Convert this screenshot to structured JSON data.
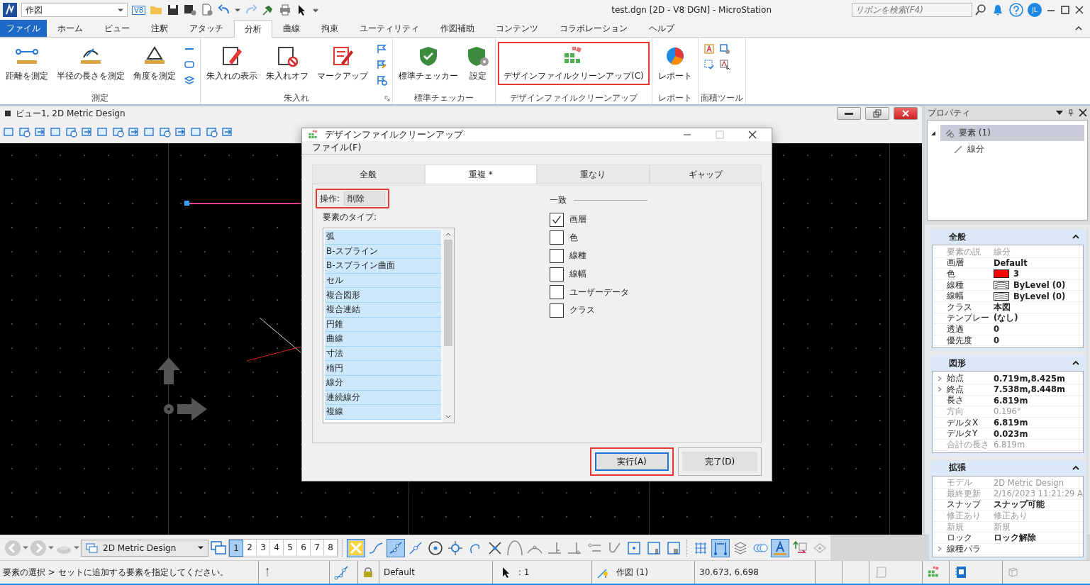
{
  "app": {
    "workflow": "作図",
    "version_badge": "V8",
    "title": "test.dgn [2D - V8 DGN] - MicroStation",
    "search": {
      "placeholder": "リボンを検索(F4)"
    },
    "user_initials": "JL"
  },
  "ribbon": {
    "tabs": [
      {
        "label": "ファイル",
        "kind": "backstage",
        "selected": false
      },
      {
        "label": "ホーム",
        "kind": "tab",
        "selected": false
      },
      {
        "label": "ビュー",
        "kind": "tab",
        "selected": false
      },
      {
        "label": "注釈",
        "kind": "tab",
        "selected": false
      },
      {
        "label": "アタッチ",
        "kind": "tab",
        "selected": false
      },
      {
        "label": "分析",
        "kind": "tab",
        "selected": true
      },
      {
        "label": "曲線",
        "kind": "tab",
        "selected": false
      },
      {
        "label": "拘束",
        "kind": "tab",
        "selected": false
      },
      {
        "label": "ユーティリティ",
        "kind": "tab",
        "selected": false
      },
      {
        "label": "作図補助",
        "kind": "tab",
        "selected": false
      },
      {
        "label": "コンテンツ",
        "kind": "tab",
        "selected": false
      },
      {
        "label": "コラボレーション",
        "kind": "tab",
        "selected": false
      },
      {
        "label": "ヘルプ",
        "kind": "tab",
        "selected": false
      }
    ],
    "groups": [
      {
        "label": "測定",
        "buttons": [
          {
            "label": "距離を測定",
            "highlighted": false
          },
          {
            "label": "半径の長さを測定",
            "highlighted": false
          },
          {
            "label": "角度を測定",
            "highlighted": false
          }
        ]
      },
      {
        "label": "朱入れ",
        "buttons": [
          {
            "label": "朱入れの表示",
            "highlighted": false
          },
          {
            "label": "朱入れオフ",
            "highlighted": false
          },
          {
            "label": "マークアップ",
            "highlighted": false
          }
        ]
      },
      {
        "label": "標準チェッカー",
        "buttons": [
          {
            "label": "標準チェッカー",
            "highlighted": false
          },
          {
            "label": "設定",
            "highlighted": false
          }
        ]
      },
      {
        "label": "デザインファイルクリーンアップ",
        "buttons": [
          {
            "label": "デザインファイルクリーンアップ(C)",
            "highlighted": true
          }
        ]
      },
      {
        "label": "レポート",
        "buttons": [
          {
            "label": "レポート",
            "highlighted": false
          }
        ]
      },
      {
        "label": "面積ツール"
      }
    ]
  },
  "view": {
    "title": "ビュー1, 2D Metric Design"
  },
  "dialog": {
    "title": "デザインファイルクリーンアップ",
    "menu": [
      "ファイル(F)"
    ],
    "tabs": [
      {
        "label": "全般",
        "selected": false
      },
      {
        "label": "重複 *",
        "selected": true
      },
      {
        "label": "重なり",
        "selected": false
      },
      {
        "label": "ギャップ",
        "selected": false
      }
    ],
    "operation": {
      "label": "操作:",
      "value": "削除",
      "highlighted": true
    },
    "types_label": "要素のタイプ:",
    "types": [
      {
        "label": "弧",
        "selected": true
      },
      {
        "label": "B-スプライン",
        "selected": true
      },
      {
        "label": "B-スプライン曲面",
        "selected": true
      },
      {
        "label": "セル",
        "selected": true
      },
      {
        "label": "複合図形",
        "selected": true
      },
      {
        "label": "複合連結",
        "selected": true
      },
      {
        "label": "円錐",
        "selected": true
      },
      {
        "label": "曲線",
        "selected": true
      },
      {
        "label": "寸法",
        "selected": true
      },
      {
        "label": "楕円",
        "selected": true
      },
      {
        "label": "線分",
        "selected": true
      },
      {
        "label": "連続線分",
        "selected": true
      },
      {
        "label": "複線",
        "selected": true
      }
    ],
    "match_label": "一致",
    "match": [
      {
        "label": "画層",
        "checked": true
      },
      {
        "label": "色",
        "checked": false
      },
      {
        "label": "線種",
        "checked": false
      },
      {
        "label": "線幅",
        "checked": false
      },
      {
        "label": "ユーザーデータ",
        "checked": false
      },
      {
        "label": "クラス",
        "checked": false
      }
    ],
    "buttons": [
      {
        "label": "実行(A)",
        "highlighted": true,
        "default": true
      },
      {
        "label": "完了(D)",
        "highlighted": false,
        "default": false
      }
    ]
  },
  "properties": {
    "title": "プロパティ",
    "tree": [
      {
        "label": "要素 (1)",
        "expanded": true,
        "selected": true,
        "children": [
          {
            "label": "線分",
            "selected": false
          }
        ]
      }
    ],
    "sections": [
      {
        "title": "全般",
        "expanded": true,
        "rows": [
          {
            "label": "要素の説",
            "value": "線分",
            "kind": "text",
            "muted": true,
            "has_children": false
          },
          {
            "label": "画層",
            "value": "Default",
            "kind": "text",
            "muted": false,
            "has_children": false
          },
          {
            "label": "色",
            "value": "3",
            "kind": "color",
            "color": "#ff0000",
            "muted": false,
            "has_children": false
          },
          {
            "label": "線種",
            "value": "ByLevel (0)",
            "kind": "linestyle",
            "muted": false,
            "has_children": false
          },
          {
            "label": "線幅",
            "value": "ByLevel (0)",
            "kind": "linestyle",
            "muted": false,
            "has_children": false
          },
          {
            "label": "クラス",
            "value": "本図",
            "kind": "text",
            "muted": false,
            "has_children": false
          },
          {
            "label": "テンプレー",
            "value": "(なし)",
            "kind": "text",
            "muted": false,
            "has_children": false
          },
          {
            "label": "透過",
            "value": "0",
            "kind": "text",
            "muted": false,
            "has_children": false
          },
          {
            "label": "優先度",
            "value": "0",
            "kind": "text",
            "muted": false,
            "has_children": false
          }
        ]
      },
      {
        "title": "図形",
        "expanded": true,
        "rows": [
          {
            "label": "始点",
            "value": "0.719m,8.425m",
            "kind": "text",
            "muted": false,
            "has_children": true
          },
          {
            "label": "終点",
            "value": "7.538m,8.448m",
            "kind": "text",
            "muted": false,
            "has_children": true
          },
          {
            "label": "長さ",
            "value": "6.819m",
            "kind": "text",
            "muted": false,
            "has_children": false
          },
          {
            "label": "方向",
            "value": "0.196°",
            "kind": "text",
            "muted": true,
            "has_children": false
          },
          {
            "label": "デルタX",
            "value": "6.819m",
            "kind": "text",
            "muted": false,
            "has_children": false
          },
          {
            "label": "デルタY",
            "value": "0.023m",
            "kind": "text",
            "muted": false,
            "has_children": false
          },
          {
            "label": "合計の長さ",
            "value": "6.819m",
            "kind": "text",
            "muted": true,
            "has_children": false
          }
        ]
      },
      {
        "title": "拡張",
        "expanded": true,
        "rows": [
          {
            "label": "モデル",
            "value": "2D Metric Design",
            "kind": "text",
            "muted": true,
            "has_children": false
          },
          {
            "label": "最終更新",
            "value": "2/16/2023 11:21:29 A",
            "kind": "text",
            "muted": true,
            "has_children": false
          },
          {
            "label": "スナップ",
            "value": "スナップ可能",
            "kind": "text",
            "muted": false,
            "has_children": false
          },
          {
            "label": "修正あり",
            "value": "修正あり",
            "kind": "text",
            "muted": true,
            "has_children": false
          },
          {
            "label": "新規",
            "value": "新規",
            "kind": "text",
            "muted": true,
            "has_children": false
          },
          {
            "label": "ロック",
            "value": "ロック解除",
            "kind": "text",
            "muted": false,
            "has_children": false
          },
          {
            "label": "線種パラ",
            "kind": "text",
            "muted": false,
            "has_children": true
          }
        ]
      }
    ]
  },
  "bottom_toolbar": {
    "view_selector": "2D Metric Design",
    "views": [
      {
        "label": "1",
        "selected": true
      },
      {
        "label": "2",
        "selected": false
      },
      {
        "label": "3",
        "selected": false
      },
      {
        "label": "4",
        "selected": false
      },
      {
        "label": "5",
        "selected": false
      },
      {
        "label": "6",
        "selected": false
      },
      {
        "label": "7",
        "selected": false
      },
      {
        "label": "8",
        "selected": false
      }
    ],
    "snaps": [
      {
        "selected": true
      },
      {
        "selected": false
      },
      {
        "selected": true
      },
      {
        "selected": false
      },
      {
        "selected": false
      },
      {
        "selected": false
      },
      {
        "selected": false
      },
      {
        "selected": false
      },
      {
        "selected": false
      },
      {
        "selected": false
      },
      {
        "selected": false
      },
      {
        "selected": false
      },
      {
        "selected": false
      },
      {
        "selected": false
      },
      {
        "selected": false
      },
      {
        "selected": false
      },
      {
        "selected": false
      }
    ],
    "display_tools": [
      {
        "selected": false
      },
      {
        "selected": true
      },
      {
        "selected": false
      },
      {
        "selected": false
      },
      {
        "selected": true
      },
      {
        "selected": false
      },
      {
        "selected": false
      }
    ]
  },
  "status_bar": {
    "prompt": "要素の選択 > セットに追加する要素を指定してください。",
    "level": "Default",
    "selection": ": 1",
    "model": "作図 (1)",
    "coordinates": "30.673, 6.698"
  }
}
